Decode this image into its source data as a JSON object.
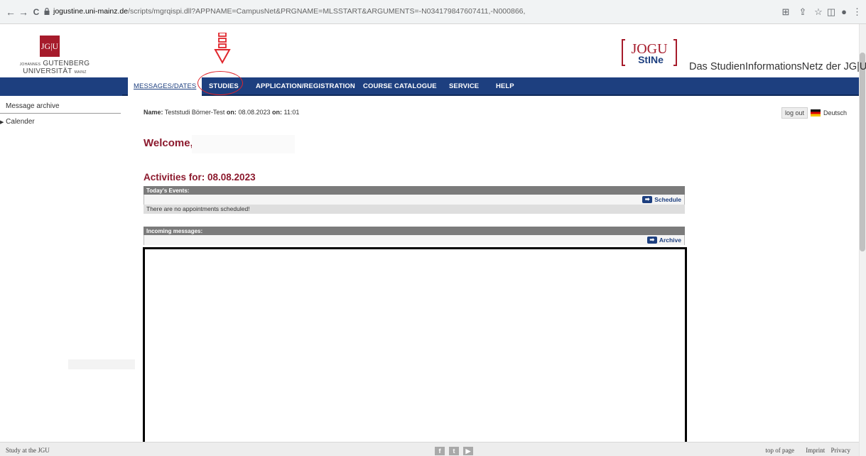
{
  "browser": {
    "url_host": "jogustine.uni-mainz.de",
    "url_path": "/scripts/mgrqispi.dll?APPNAME=CampusNet&PRGNAME=MLSSTART&ARGUMENTS=-N034179847607411,-N000866,",
    "back": "←",
    "forward": "→",
    "reload": "C"
  },
  "header": {
    "jgu_logo_text": "JG|U",
    "jgu_prefix": "JOHANNES",
    "jgu_line1": "GUTENBERG",
    "jgu_line2": "UNIVERSITÄT",
    "jgu_suffix": "MAINZ",
    "jogu_logo_top": "JOGU",
    "jogu_logo_bottom": "StINe",
    "site_title": "Das StudienInformationsNetz der JG|U"
  },
  "nav": {
    "items": [
      "MESSAGES/DATES",
      "STUDIES",
      "APPLICATION/REGISTRATION",
      "COURSE CATALOGUE",
      "SERVICE",
      "HELP"
    ]
  },
  "sidebar": {
    "items": [
      "Message archive",
      "Calender"
    ],
    "calender_marker": "▶"
  },
  "content": {
    "name_label": "Name:",
    "name_value": "Teststudi Börner-Test",
    "on_label": "on:",
    "date_value": "08.08.2023",
    "on_label2": "on:",
    "time_value": "11:01",
    "logout": "log out",
    "language": "Deutsch",
    "welcome": "Welcome,",
    "activities": "Activities for: 08.08.2023",
    "events_head": "Today's Events:",
    "schedule_link": "Schedule",
    "events_note": "There are no appointments scheduled!",
    "messages_head": "Incoming messages:",
    "archive_link": "Archive"
  },
  "footer": {
    "left": "Study at the JGU",
    "top_of_page": "top of page",
    "imprint": "Imprint",
    "privacy": "Privacy",
    "social": [
      "f",
      "t",
      "▶"
    ]
  },
  "colors": {
    "nav_blue": "#1d3f7f",
    "jgu_red": "#a61b2b",
    "heading_red": "#8c1a2e",
    "highlight_red": "#e0262c"
  }
}
